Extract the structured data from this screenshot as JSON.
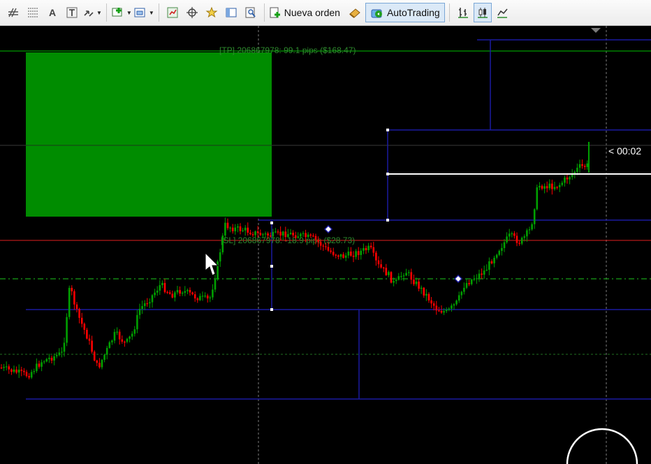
{
  "toolbar": {
    "new_order_label": "Nueva orden",
    "autotrading_label": "AutoTrading",
    "text_tool_label": "A",
    "buttons": [
      "crosshair-icon",
      "period-separators-icon",
      "text-icon",
      "text-label-icon",
      "arrows-icon",
      "new-chart-icon",
      "templates-icon",
      "market-watch-icon",
      "navigator-icon",
      "favorites-icon",
      "data-window-icon",
      "strategy-tester-icon",
      "new-order-icon",
      "oneclick-icon",
      "autotrading-icon",
      "bar-chart-icon",
      "candlestick-icon",
      "line-chart-icon"
    ]
  },
  "chart": {
    "tp_label": "[TP] 206867978: 99.1 pips ($168.47)",
    "sl_label": "[SL] 206867978: -18.9 pips ($28.73)",
    "countdown_label": "< 00:02",
    "colors": {
      "background": "#000000",
      "bull": "#00a000",
      "bear": "#ff0000",
      "tp_line": "#00c000",
      "sl_line": "#ff2020",
      "zone": "#008c00",
      "object": "#1a1aa0",
      "bid": "#ffffff"
    }
  }
}
